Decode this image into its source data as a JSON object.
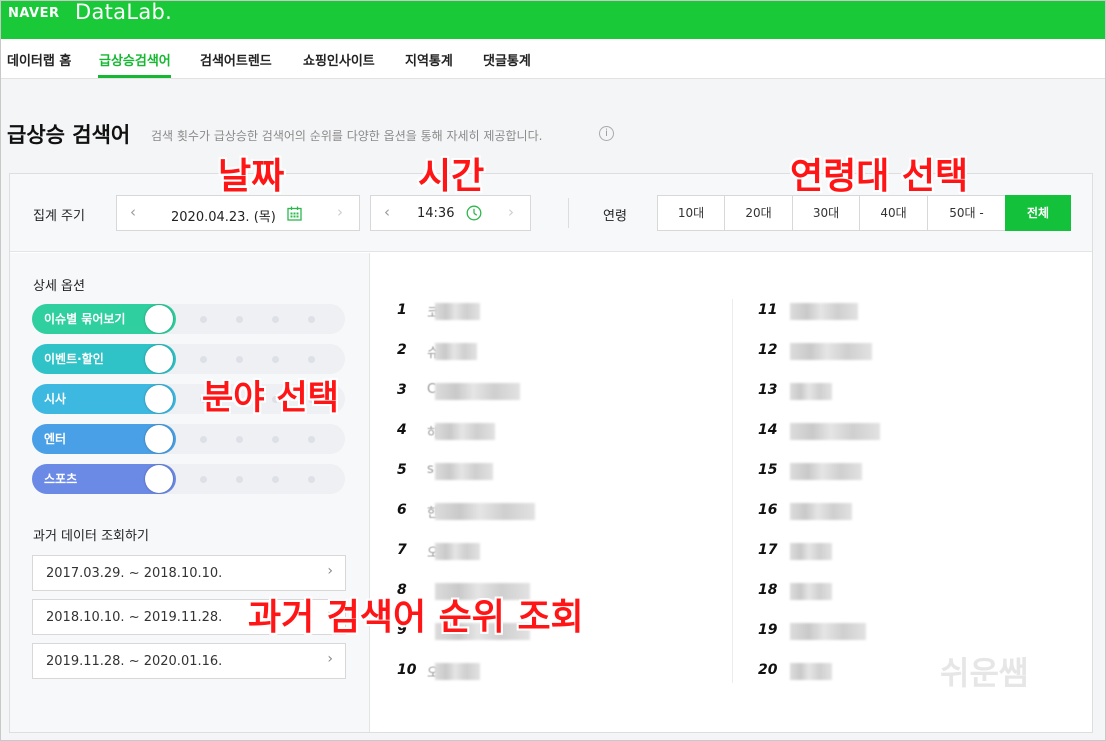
{
  "header": {
    "brand": "NAVER",
    "product": "DataLab."
  },
  "nav": {
    "items": [
      {
        "label": "데이터랩 홈",
        "active": false
      },
      {
        "label": "급상승검색어",
        "active": true
      },
      {
        "label": "검색어트렌드",
        "active": false
      },
      {
        "label": "쇼핑인사이트",
        "active": false
      },
      {
        "label": "지역통계",
        "active": false
      },
      {
        "label": "댓글통계",
        "active": false
      }
    ]
  },
  "page": {
    "title": "급상승 검색어",
    "subtitle": "검색 횟수가 급상승한 검색어의 순위를 다양한 옵션을 통해 자세히 제공합니다.",
    "info_icon": "i"
  },
  "filters": {
    "period_label": "집계 주기",
    "date_value": "2020.04.23. (목)",
    "time_value": "14:36",
    "age_label": "연령",
    "age_buttons": [
      {
        "label": "10대",
        "active": false
      },
      {
        "label": "20대",
        "active": false
      },
      {
        "label": "30대",
        "active": false
      },
      {
        "label": "40대",
        "active": false
      },
      {
        "label": "50대 -",
        "active": false
      },
      {
        "label": "전체",
        "active": true
      }
    ]
  },
  "options": {
    "label": "상세 옵션",
    "toggles": [
      {
        "label": "이슈별 묶어보기",
        "color": "#2fcf9f"
      },
      {
        "label": "이벤트·할인",
        "color": "#2fc2c6"
      },
      {
        "label": "시사",
        "color": "#3db8e0"
      },
      {
        "label": "엔터",
        "color": "#4aa0e6"
      },
      {
        "label": "스포츠",
        "color": "#6b8ae6"
      }
    ]
  },
  "past": {
    "label": "과거 데이터 조회하기",
    "items": [
      "2017.03.29. ~ 2018.10.10.",
      "2018.10.10. ~ 2019.11.28.",
      "2019.11.28. ~ 2020.01.16."
    ]
  },
  "ranking": {
    "left": [
      {
        "rank": "1",
        "initial": "코"
      },
      {
        "rank": "2",
        "initial": "슈"
      },
      {
        "rank": "3",
        "initial": "C"
      },
      {
        "rank": "4",
        "initial": "하"
      },
      {
        "rank": "5",
        "initial": "s"
      },
      {
        "rank": "6",
        "initial": "한"
      },
      {
        "rank": "7",
        "initial": "오"
      },
      {
        "rank": "8",
        "initial": ""
      },
      {
        "rank": "9",
        "initial": ""
      },
      {
        "rank": "10",
        "initial": "오"
      }
    ],
    "right": [
      "11",
      "12",
      "13",
      "14",
      "15",
      "16",
      "17",
      "18",
      "19",
      "20"
    ]
  },
  "watermark": "쉬운쌤",
  "annotations": {
    "date": "날짜",
    "time": "시간",
    "age": "연령대 선택",
    "category": "분야 선택",
    "past": "과거 검색어 순위 조회"
  }
}
